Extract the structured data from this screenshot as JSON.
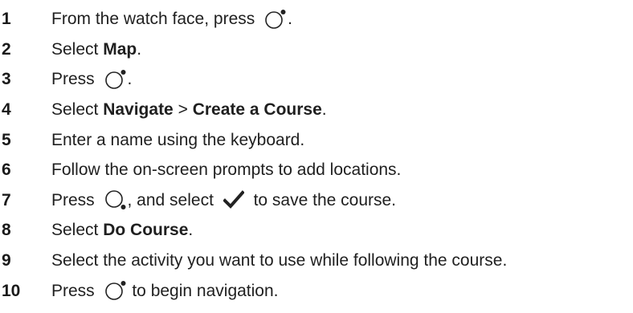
{
  "steps": [
    {
      "number": "1",
      "parts": [
        {
          "t": "text",
          "v": "From the watch face, press "
        },
        {
          "t": "icon",
          "v": "watch-button-upper-right-icon"
        },
        {
          "t": "text",
          "v": "."
        }
      ]
    },
    {
      "number": "2",
      "parts": [
        {
          "t": "text",
          "v": "Select "
        },
        {
          "t": "bold",
          "v": "Map"
        },
        {
          "t": "text",
          "v": "."
        }
      ]
    },
    {
      "number": "3",
      "parts": [
        {
          "t": "text",
          "v": "Press "
        },
        {
          "t": "icon",
          "v": "watch-button-upper-right-icon"
        },
        {
          "t": "text",
          "v": "."
        }
      ]
    },
    {
      "number": "4",
      "parts": [
        {
          "t": "text",
          "v": "Select "
        },
        {
          "t": "bold",
          "v": "Navigate"
        },
        {
          "t": "text",
          "v": " > "
        },
        {
          "t": "bold",
          "v": "Create a Course"
        },
        {
          "t": "text",
          "v": "."
        }
      ]
    },
    {
      "number": "5",
      "parts": [
        {
          "t": "text",
          "v": "Enter a name using the keyboard."
        }
      ]
    },
    {
      "number": "6",
      "parts": [
        {
          "t": "text",
          "v": "Follow the on-screen prompts to add locations."
        }
      ]
    },
    {
      "number": "7",
      "parts": [
        {
          "t": "text",
          "v": "Press "
        },
        {
          "t": "icon",
          "v": "watch-button-lower-right-icon"
        },
        {
          "t": "text",
          "v": ", and select "
        },
        {
          "t": "icon",
          "v": "checkmark-icon"
        },
        {
          "t": "text",
          "v": " to save the course."
        }
      ]
    },
    {
      "number": "8",
      "parts": [
        {
          "t": "text",
          "v": "Select "
        },
        {
          "t": "bold",
          "v": "Do Course"
        },
        {
          "t": "text",
          "v": "."
        }
      ]
    },
    {
      "number": "9",
      "parts": [
        {
          "t": "text",
          "v": "Select the activity you want to use while following the course."
        }
      ]
    },
    {
      "number": "10",
      "parts": [
        {
          "t": "text",
          "v": "Press "
        },
        {
          "t": "icon",
          "v": "watch-button-upper-right-icon"
        },
        {
          "t": "text",
          "v": " to begin navigation."
        }
      ]
    }
  ]
}
